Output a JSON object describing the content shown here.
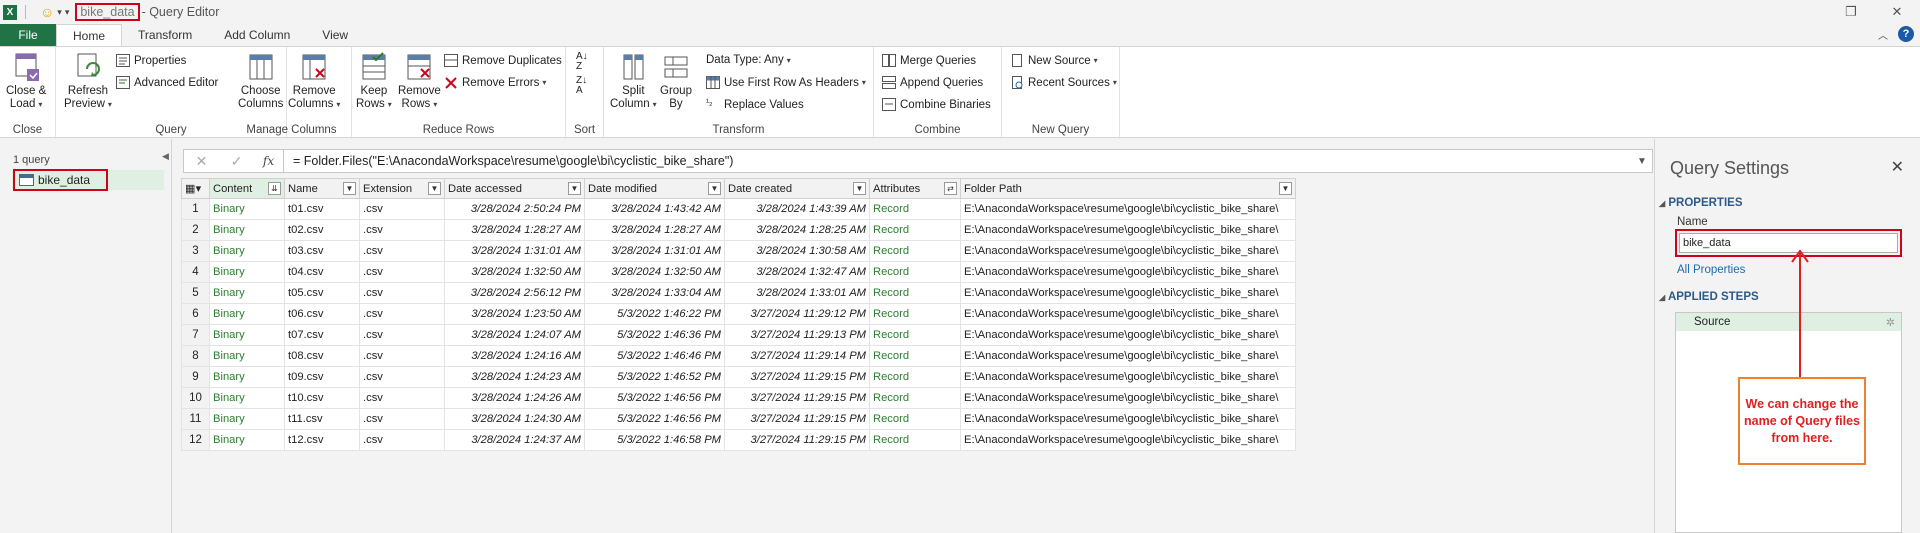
{
  "titlebar": {
    "app_icon": "X",
    "query_name": "bike_data",
    "title_suffix": "- Query Editor",
    "restore_icon": "restore-icon",
    "close_icon": "close-icon"
  },
  "tabs": [
    "File",
    "Home",
    "Transform",
    "Add Column",
    "View"
  ],
  "ribbon": {
    "close_load": "Close &",
    "close_load2": "Load",
    "refresh": "Refresh",
    "refresh2": "Preview",
    "properties": "Properties",
    "advanced_editor": "Advanced Editor",
    "choose_columns": "Choose",
    "choose_columns2": "Columns",
    "remove_columns": "Remove",
    "remove_columns2": "Columns",
    "keep_rows": "Keep",
    "keep_rows2": "Rows",
    "remove_rows": "Remove",
    "remove_rows2": "Rows",
    "remove_duplicates": "Remove Duplicates",
    "remove_errors": "Remove Errors",
    "split_column": "Split",
    "split_column2": "Column",
    "group_by": "Group",
    "group_by2": "By",
    "data_type": "Data Type: Any",
    "use_first_row": "Use First Row As Headers",
    "replace_values": "Replace Values",
    "merge_queries": "Merge Queries",
    "append_queries": "Append Queries",
    "combine_binaries": "Combine Binaries",
    "new_source": "New Source",
    "recent_sources": "Recent Sources",
    "groups": {
      "close": "Close",
      "query": "Query",
      "manage_columns": "Manage Columns",
      "reduce_rows": "Reduce Rows",
      "sort": "Sort",
      "transform": "Transform",
      "combine": "Combine",
      "new_query": "New Query"
    }
  },
  "leftnav": {
    "count": "1 query",
    "item": "bike_data"
  },
  "formula": {
    "fx": "fx",
    "text": "= Folder.Files(\"E:\\AnacondaWorkspace\\resume\\google\\bi\\cyclistic_bike_share\")"
  },
  "grid": {
    "columns": [
      "Content",
      "Name",
      "Extension",
      "Date accessed",
      "Date modified",
      "Date created",
      "Attributes",
      "Folder Path"
    ],
    "rows": [
      [
        "1",
        "Binary",
        "t01.csv",
        ".csv",
        "3/28/2024 2:50:24 PM",
        "3/28/2024 1:43:42 AM",
        "3/28/2024 1:43:39 AM",
        "Record",
        "E:\\AnacondaWorkspace\\resume\\google\\bi\\cyclistic_bike_share\\"
      ],
      [
        "2",
        "Binary",
        "t02.csv",
        ".csv",
        "3/28/2024 1:28:27 AM",
        "3/28/2024 1:28:27 AM",
        "3/28/2024 1:28:25 AM",
        "Record",
        "E:\\AnacondaWorkspace\\resume\\google\\bi\\cyclistic_bike_share\\"
      ],
      [
        "3",
        "Binary",
        "t03.csv",
        ".csv",
        "3/28/2024 1:31:01 AM",
        "3/28/2024 1:31:01 AM",
        "3/28/2024 1:30:58 AM",
        "Record",
        "E:\\AnacondaWorkspace\\resume\\google\\bi\\cyclistic_bike_share\\"
      ],
      [
        "4",
        "Binary",
        "t04.csv",
        ".csv",
        "3/28/2024 1:32:50 AM",
        "3/28/2024 1:32:50 AM",
        "3/28/2024 1:32:47 AM",
        "Record",
        "E:\\AnacondaWorkspace\\resume\\google\\bi\\cyclistic_bike_share\\"
      ],
      [
        "5",
        "Binary",
        "t05.csv",
        ".csv",
        "3/28/2024 2:56:12 PM",
        "3/28/2024 1:33:04 AM",
        "3/28/2024 1:33:01 AM",
        "Record",
        "E:\\AnacondaWorkspace\\resume\\google\\bi\\cyclistic_bike_share\\"
      ],
      [
        "6",
        "Binary",
        "t06.csv",
        ".csv",
        "3/28/2024 1:23:50 AM",
        "5/3/2022 1:46:22 PM",
        "3/27/2024 11:29:12 PM",
        "Record",
        "E:\\AnacondaWorkspace\\resume\\google\\bi\\cyclistic_bike_share\\"
      ],
      [
        "7",
        "Binary",
        "t07.csv",
        ".csv",
        "3/28/2024 1:24:07 AM",
        "5/3/2022 1:46:36 PM",
        "3/27/2024 11:29:13 PM",
        "Record",
        "E:\\AnacondaWorkspace\\resume\\google\\bi\\cyclistic_bike_share\\"
      ],
      [
        "8",
        "Binary",
        "t08.csv",
        ".csv",
        "3/28/2024 1:24:16 AM",
        "5/3/2022 1:46:46 PM",
        "3/27/2024 11:29:14 PM",
        "Record",
        "E:\\AnacondaWorkspace\\resume\\google\\bi\\cyclistic_bike_share\\"
      ],
      [
        "9",
        "Binary",
        "t09.csv",
        ".csv",
        "3/28/2024 1:24:23 AM",
        "5/3/2022 1:46:52 PM",
        "3/27/2024 11:29:15 PM",
        "Record",
        "E:\\AnacondaWorkspace\\resume\\google\\bi\\cyclistic_bike_share\\"
      ],
      [
        "10",
        "Binary",
        "t10.csv",
        ".csv",
        "3/28/2024 1:24:26 AM",
        "5/3/2022 1:46:56 PM",
        "3/27/2024 11:29:15 PM",
        "Record",
        "E:\\AnacondaWorkspace\\resume\\google\\bi\\cyclistic_bike_share\\"
      ],
      [
        "11",
        "Binary",
        "t11.csv",
        ".csv",
        "3/28/2024 1:24:30 AM",
        "5/3/2022 1:46:56 PM",
        "3/27/2024 11:29:15 PM",
        "Record",
        "E:\\AnacondaWorkspace\\resume\\google\\bi\\cyclistic_bike_share\\"
      ],
      [
        "12",
        "Binary",
        "t12.csv",
        ".csv",
        "3/28/2024 1:24:37 AM",
        "5/3/2022 1:46:58 PM",
        "3/27/2024 11:29:15 PM",
        "Record",
        "E:\\AnacondaWorkspace\\resume\\google\\bi\\cyclistic_bike_share\\"
      ]
    ]
  },
  "query_settings": {
    "title": "Query Settings",
    "properties": "PROPERTIES",
    "name_label": "Name",
    "name_value": "bike_data",
    "all_properties": "All Properties",
    "applied_steps": "APPLIED STEPS",
    "steps": [
      "Source"
    ]
  },
  "annotation": {
    "text": "We can change the name of Query files from here."
  },
  "colors": {
    "accent_green": "#217346",
    "annotation_red": "#d0021b",
    "annotation_border": "#f08030"
  }
}
